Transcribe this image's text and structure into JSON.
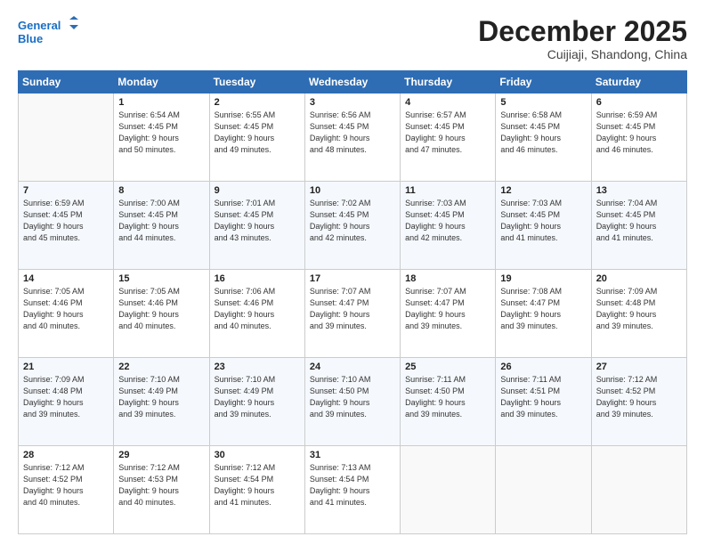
{
  "header": {
    "logo_line1": "General",
    "logo_line2": "Blue",
    "month": "December 2025",
    "location": "Cuijiaji, Shandong, China"
  },
  "days_of_week": [
    "Sunday",
    "Monday",
    "Tuesday",
    "Wednesday",
    "Thursday",
    "Friday",
    "Saturday"
  ],
  "weeks": [
    [
      {
        "day": "",
        "info": ""
      },
      {
        "day": "1",
        "info": "Sunrise: 6:54 AM\nSunset: 4:45 PM\nDaylight: 9 hours\nand 50 minutes."
      },
      {
        "day": "2",
        "info": "Sunrise: 6:55 AM\nSunset: 4:45 PM\nDaylight: 9 hours\nand 49 minutes."
      },
      {
        "day": "3",
        "info": "Sunrise: 6:56 AM\nSunset: 4:45 PM\nDaylight: 9 hours\nand 48 minutes."
      },
      {
        "day": "4",
        "info": "Sunrise: 6:57 AM\nSunset: 4:45 PM\nDaylight: 9 hours\nand 47 minutes."
      },
      {
        "day": "5",
        "info": "Sunrise: 6:58 AM\nSunset: 4:45 PM\nDaylight: 9 hours\nand 46 minutes."
      },
      {
        "day": "6",
        "info": "Sunrise: 6:59 AM\nSunset: 4:45 PM\nDaylight: 9 hours\nand 46 minutes."
      }
    ],
    [
      {
        "day": "7",
        "info": "Sunrise: 6:59 AM\nSunset: 4:45 PM\nDaylight: 9 hours\nand 45 minutes."
      },
      {
        "day": "8",
        "info": "Sunrise: 7:00 AM\nSunset: 4:45 PM\nDaylight: 9 hours\nand 44 minutes."
      },
      {
        "day": "9",
        "info": "Sunrise: 7:01 AM\nSunset: 4:45 PM\nDaylight: 9 hours\nand 43 minutes."
      },
      {
        "day": "10",
        "info": "Sunrise: 7:02 AM\nSunset: 4:45 PM\nDaylight: 9 hours\nand 42 minutes."
      },
      {
        "day": "11",
        "info": "Sunrise: 7:03 AM\nSunset: 4:45 PM\nDaylight: 9 hours\nand 42 minutes."
      },
      {
        "day": "12",
        "info": "Sunrise: 7:03 AM\nSunset: 4:45 PM\nDaylight: 9 hours\nand 41 minutes."
      },
      {
        "day": "13",
        "info": "Sunrise: 7:04 AM\nSunset: 4:45 PM\nDaylight: 9 hours\nand 41 minutes."
      }
    ],
    [
      {
        "day": "14",
        "info": "Sunrise: 7:05 AM\nSunset: 4:46 PM\nDaylight: 9 hours\nand 40 minutes."
      },
      {
        "day": "15",
        "info": "Sunrise: 7:05 AM\nSunset: 4:46 PM\nDaylight: 9 hours\nand 40 minutes."
      },
      {
        "day": "16",
        "info": "Sunrise: 7:06 AM\nSunset: 4:46 PM\nDaylight: 9 hours\nand 40 minutes."
      },
      {
        "day": "17",
        "info": "Sunrise: 7:07 AM\nSunset: 4:47 PM\nDaylight: 9 hours\nand 39 minutes."
      },
      {
        "day": "18",
        "info": "Sunrise: 7:07 AM\nSunset: 4:47 PM\nDaylight: 9 hours\nand 39 minutes."
      },
      {
        "day": "19",
        "info": "Sunrise: 7:08 AM\nSunset: 4:47 PM\nDaylight: 9 hours\nand 39 minutes."
      },
      {
        "day": "20",
        "info": "Sunrise: 7:09 AM\nSunset: 4:48 PM\nDaylight: 9 hours\nand 39 minutes."
      }
    ],
    [
      {
        "day": "21",
        "info": "Sunrise: 7:09 AM\nSunset: 4:48 PM\nDaylight: 9 hours\nand 39 minutes."
      },
      {
        "day": "22",
        "info": "Sunrise: 7:10 AM\nSunset: 4:49 PM\nDaylight: 9 hours\nand 39 minutes."
      },
      {
        "day": "23",
        "info": "Sunrise: 7:10 AM\nSunset: 4:49 PM\nDaylight: 9 hours\nand 39 minutes."
      },
      {
        "day": "24",
        "info": "Sunrise: 7:10 AM\nSunset: 4:50 PM\nDaylight: 9 hours\nand 39 minutes."
      },
      {
        "day": "25",
        "info": "Sunrise: 7:11 AM\nSunset: 4:50 PM\nDaylight: 9 hours\nand 39 minutes."
      },
      {
        "day": "26",
        "info": "Sunrise: 7:11 AM\nSunset: 4:51 PM\nDaylight: 9 hours\nand 39 minutes."
      },
      {
        "day": "27",
        "info": "Sunrise: 7:12 AM\nSunset: 4:52 PM\nDaylight: 9 hours\nand 39 minutes."
      }
    ],
    [
      {
        "day": "28",
        "info": "Sunrise: 7:12 AM\nSunset: 4:52 PM\nDaylight: 9 hours\nand 40 minutes."
      },
      {
        "day": "29",
        "info": "Sunrise: 7:12 AM\nSunset: 4:53 PM\nDaylight: 9 hours\nand 40 minutes."
      },
      {
        "day": "30",
        "info": "Sunrise: 7:12 AM\nSunset: 4:54 PM\nDaylight: 9 hours\nand 41 minutes."
      },
      {
        "day": "31",
        "info": "Sunrise: 7:13 AM\nSunset: 4:54 PM\nDaylight: 9 hours\nand 41 minutes."
      },
      {
        "day": "",
        "info": ""
      },
      {
        "day": "",
        "info": ""
      },
      {
        "day": "",
        "info": ""
      }
    ]
  ]
}
